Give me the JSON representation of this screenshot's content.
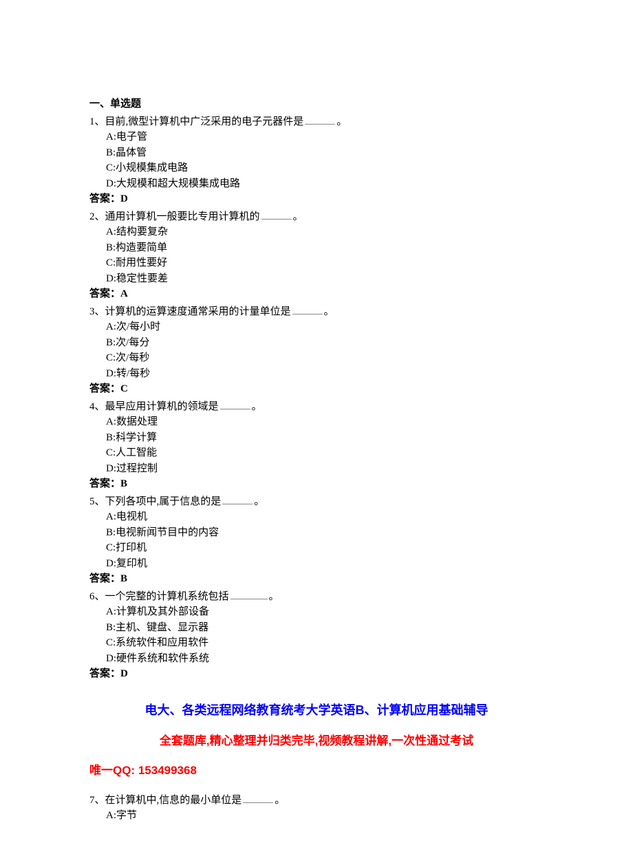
{
  "section_title": "一、单选题",
  "blank_suffix": "。",
  "questions": [
    {
      "num": "1、",
      "stem": "目前,微型计算机中广泛采用的电子元器件是",
      "blank": true,
      "options": [
        "A:电子管",
        "B:晶体管",
        "C:小规模集成电路",
        "D:大规模和超大规模集成电路"
      ],
      "answer_label": "答案：",
      "answer": "D"
    },
    {
      "num": "2、",
      "stem": "通用计算机一般要比专用计算机的",
      "blank": true,
      "options": [
        "A:结构要复杂",
        "B:构造要简单",
        "C:耐用性要好",
        "D:稳定性要差"
      ],
      "answer_label": "答案：",
      "answer": "A"
    },
    {
      "num": "3、",
      "stem": "计算机的运算速度通常采用的计量单位是",
      "blank": true,
      "options": [
        "A:次/每小时",
        "B:次/每分",
        "C:次/每秒",
        "D:转/每秒"
      ],
      "answer_label": "答案：",
      "answer": "C"
    },
    {
      "num": "4、",
      "stem": "最早应用计算机的领域是",
      "blank": true,
      "options": [
        "A:数据处理",
        "B:科学计算",
        "C:人工智能",
        "D:过程控制"
      ],
      "answer_label": "答案：",
      "answer": "B"
    },
    {
      "num": "5、",
      "stem": "下列各项中,属于信息的是",
      "blank": true,
      "options": [
        "A:电视机",
        "B:电视新闻节目中的内容",
        "C:打印机",
        "D:复印机"
      ],
      "answer_label": "答案：",
      "answer": "B"
    },
    {
      "num": "6、",
      "stem": "一个完整的计算机系统包括",
      "blank": true,
      "blank_wide": true,
      "options": [
        "A:计算机及其外部设备",
        "B:主机、键盘、显示器",
        "C:系统软件和应用软件",
        "D:硬件系统和软件系统"
      ],
      "answer_label": "答案：",
      "answer": "D"
    }
  ],
  "promo": {
    "line1": "电大、各类远程网络教育统考大学英语B、计算机应用基础辅导",
    "line2": "全套题库,精心整理并归类完毕,视频教程讲解,一次性通过考试",
    "line3": "唯一QQ: 153499368"
  },
  "tail_question": {
    "num": "7、",
    "stem": "在计算机中,信息的最小单位是",
    "blank": true,
    "options_partial": [
      "A:字节"
    ]
  }
}
